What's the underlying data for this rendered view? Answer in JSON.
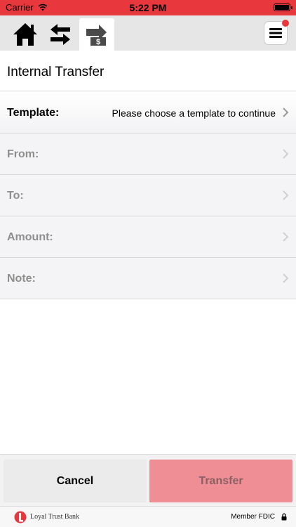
{
  "status_bar": {
    "carrier": "Carrier",
    "time": "5:22 PM",
    "wifi_icon": "wifi-icon",
    "battery_icon": "battery-full-icon"
  },
  "toolbar": {
    "items": [
      {
        "name": "home",
        "icon": "home-icon"
      },
      {
        "name": "transfers",
        "icon": "swap-arrows-icon"
      },
      {
        "name": "internal-transfer",
        "icon": "transfer-dollar-icon",
        "selected": true
      }
    ],
    "menu_icon": "hamburger-menu-icon",
    "notification_color": "#e8383d"
  },
  "page": {
    "title": "Internal Transfer"
  },
  "form": {
    "rows": [
      {
        "label": "Template:",
        "value": "Please choose a template to continue",
        "enabled": true
      },
      {
        "label": "From:",
        "value": "",
        "enabled": false
      },
      {
        "label": "To:",
        "value": "",
        "enabled": false
      },
      {
        "label": "Amount:",
        "value": "",
        "enabled": false
      },
      {
        "label": "Note:",
        "value": "",
        "enabled": false
      }
    ]
  },
  "actions": {
    "cancel_label": "Cancel",
    "transfer_label": "Transfer",
    "transfer_enabled": false
  },
  "footer": {
    "bank_name": "Loyal Trust Bank",
    "fdic_label": "Member FDIC",
    "lock_icon": "lock-icon"
  },
  "colors": {
    "brand_red": "#e8383d",
    "transfer_disabled": "#ef8f95"
  }
}
